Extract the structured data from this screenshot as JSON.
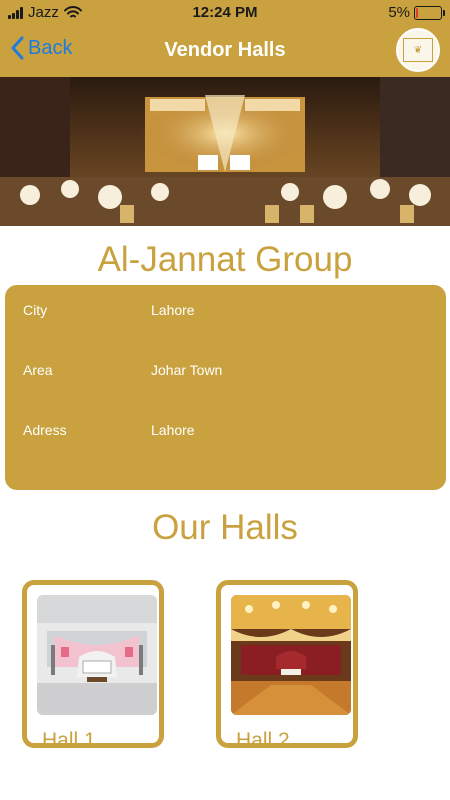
{
  "status_bar": {
    "carrier": "Jazz",
    "time": "12:24 PM",
    "battery_text": "5%",
    "battery_level": 0.05
  },
  "nav": {
    "back_label": "Back",
    "title": "Vendor Halls"
  },
  "vendor": {
    "name": "Al-Jannat Group",
    "details": [
      {
        "label": "City",
        "value": "Lahore"
      },
      {
        "label": "Area",
        "value": "Johar Town"
      },
      {
        "label": "Adress",
        "value": "Lahore"
      }
    ]
  },
  "halls_heading": "Our Halls",
  "halls": [
    {
      "label": "Hall 1"
    },
    {
      "label": "Hall 2"
    }
  ],
  "colors": {
    "primary": "#c9a23f",
    "link": "#1e7be0",
    "battery_low": "#e23b2b"
  },
  "icons": [
    "signal-icon",
    "wifi-icon",
    "battery-icon",
    "back-chevron-icon",
    "vendor-logo"
  ]
}
